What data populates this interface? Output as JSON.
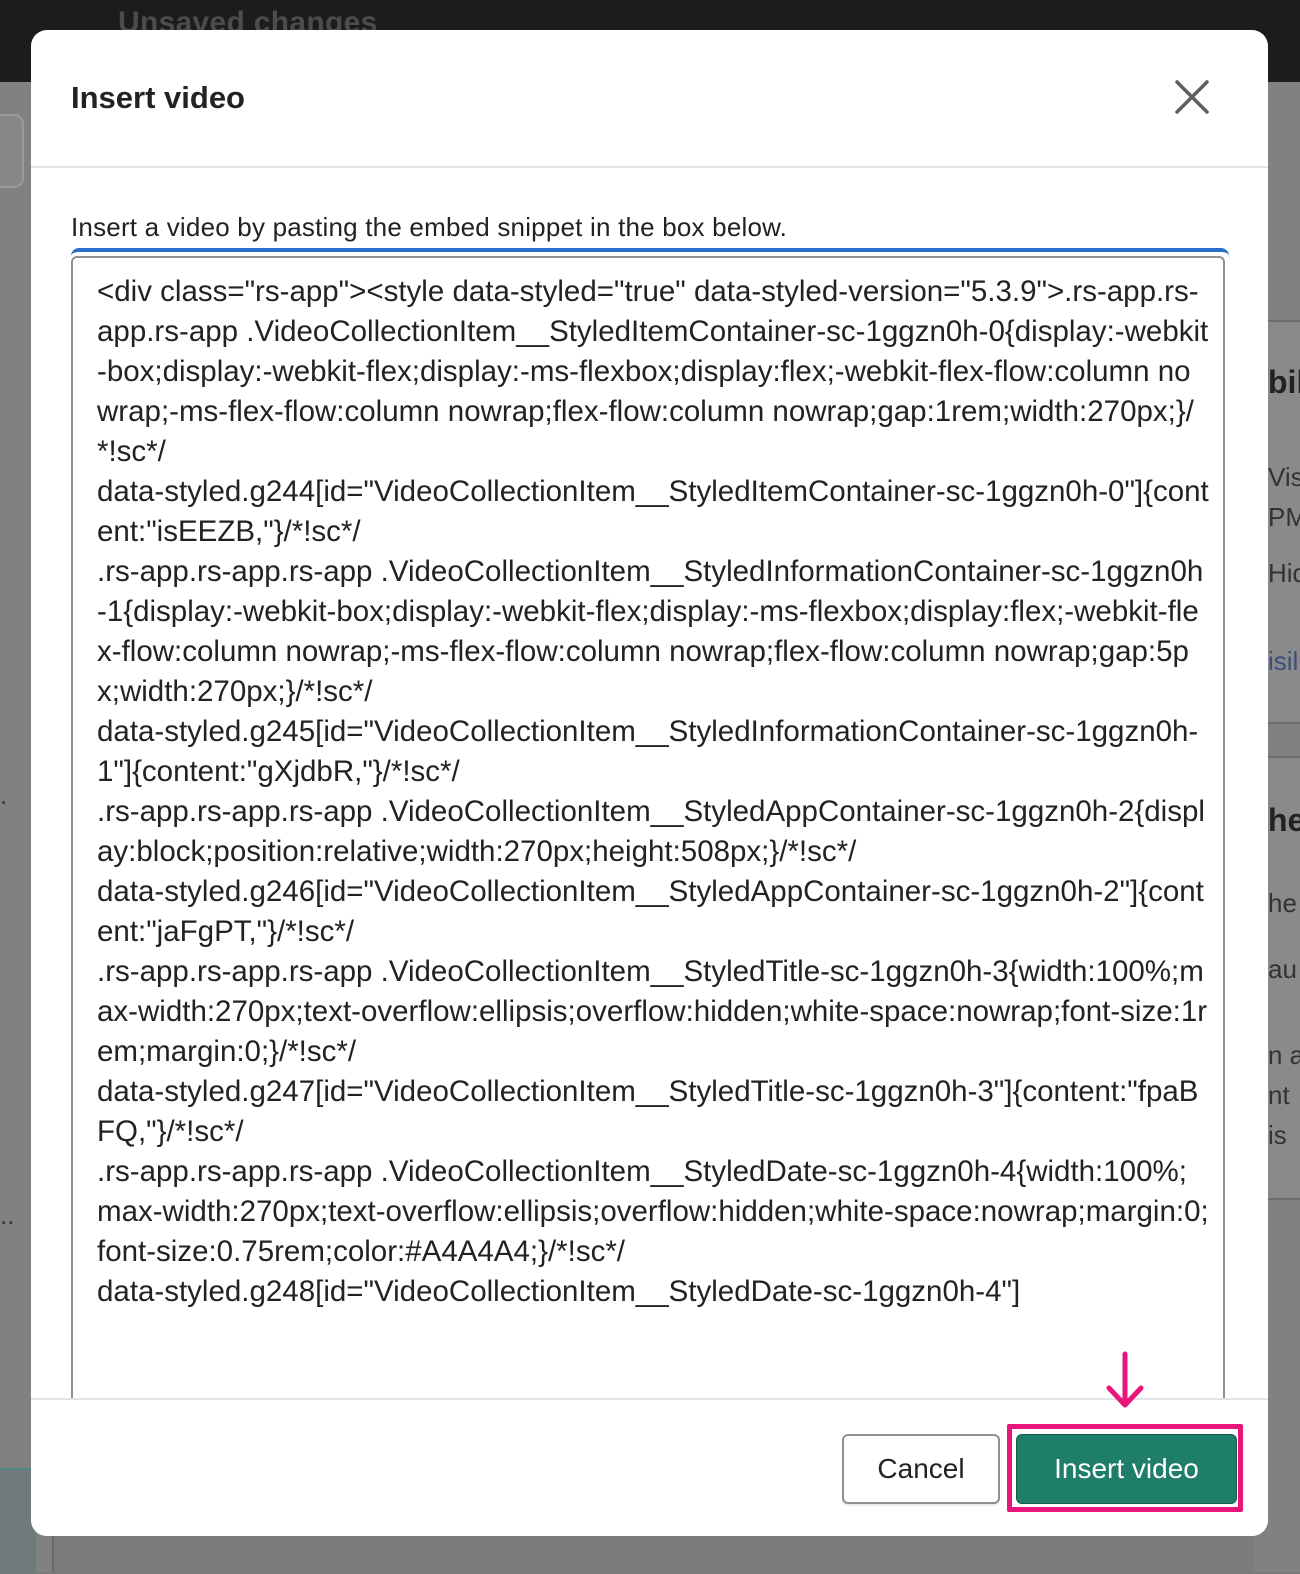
{
  "background": {
    "topbar_title": "Unsaved changes",
    "right_card_fragments": [
      "bili",
      "Visi",
      "PM",
      "Hid",
      "isil",
      "he",
      "he",
      "au",
      "n a",
      "nt",
      "is"
    ],
    "left_fragments": [
      ".",
      ".."
    ]
  },
  "modal": {
    "title": "Insert video",
    "close_label": "Close",
    "instruction": "Insert a video by pasting the embed snippet in the box below.",
    "snippet": "<div class=\"rs-app\"><style data-styled=\"true\" data-styled-version=\"5.3.9\">.rs-app.rs-app.rs-app .VideoCollectionItem__StyledItemContainer-sc-1ggzn0h-0{display:-webkit-box;display:-webkit-flex;display:-ms-flexbox;display:flex;-webkit-flex-flow:column nowrap;-ms-flex-flow:column nowrap;flex-flow:column nowrap;gap:1rem;width:270px;}/*!sc*/\ndata-styled.g244[id=\"VideoCollectionItem__StyledItemContainer-sc-1ggzn0h-0\"]{content:\"isEEZB,\"}/*!sc*/\n.rs-app.rs-app.rs-app .VideoCollectionItem__StyledInformationContainer-sc-1ggzn0h-1{display:-webkit-box;display:-webkit-flex;display:-ms-flexbox;display:flex;-webkit-flex-flow:column nowrap;-ms-flex-flow:column nowrap;flex-flow:column nowrap;gap:5px;width:270px;}/*!sc*/\ndata-styled.g245[id=\"VideoCollectionItem__StyledInformationContainer-sc-1ggzn0h-1\"]{content:\"gXjdbR,\"}/*!sc*/\n.rs-app.rs-app.rs-app .VideoCollectionItem__StyledAppContainer-sc-1ggzn0h-2{display:block;position:relative;width:270px;height:508px;}/*!sc*/\ndata-styled.g246[id=\"VideoCollectionItem__StyledAppContainer-sc-1ggzn0h-2\"]{content:\"jaFgPT,\"}/*!sc*/\n.rs-app.rs-app.rs-app .VideoCollectionItem__StyledTitle-sc-1ggzn0h-3{width:100%;max-width:270px;text-overflow:ellipsis;overflow:hidden;white-space:nowrap;font-size:1rem;margin:0;}/*!sc*/\ndata-styled.g247[id=\"VideoCollectionItem__StyledTitle-sc-1ggzn0h-3\"]{content:\"fpaBFQ,\"}/*!sc*/\n.rs-app.rs-app.rs-app .VideoCollectionItem__StyledDate-sc-1ggzn0h-4{width:100%;max-width:270px;text-overflow:ellipsis;overflow:hidden;white-space:nowrap;margin:0;font-size:0.75rem;color:#A4A4A4;}/*!sc*/\ndata-styled.g248[id=\"VideoCollectionItem__StyledDate-sc-1ggzn0h-4\"]",
    "cancel_label": "Cancel",
    "insert_label": "Insert video"
  },
  "colors": {
    "primary_button": "#1e7e6a",
    "highlight": "#e8157a",
    "focus_ring": "#2c6ecb"
  },
  "icons": {
    "close": "close-icon",
    "annotation_arrow": "arrow-down-icon"
  }
}
